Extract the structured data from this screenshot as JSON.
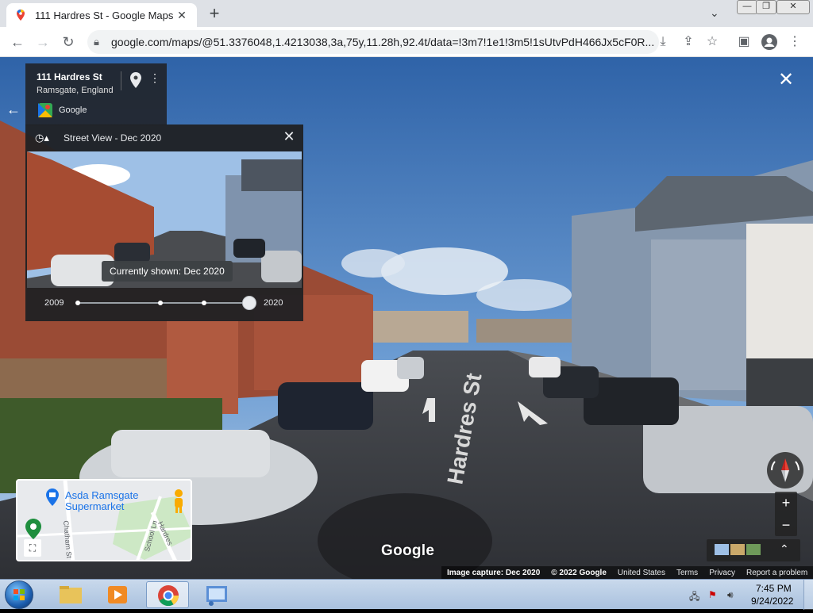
{
  "browser": {
    "tab_title": "111 Hardres St - Google Maps",
    "tab_close": "✕",
    "new_tab": "+",
    "tab_dropdown": "⌄",
    "url": "google.com/maps/@51.3376048,1.4213038,3a,75y,11.28h,92.4t/data=!3m7!1e1!3m5!1sUtvPdH466Jx5cF0R...",
    "window_controls": [
      "—",
      "❐",
      "✕"
    ]
  },
  "place": {
    "title": "111 Hardres St",
    "subtitle": "Ramsgate, England",
    "source": "Google"
  },
  "time_travel": {
    "header": "Street View - Dec 2020",
    "tooltip": "Currently shown: Dec 2020",
    "year_start": "2009",
    "year_end": "2020"
  },
  "minimap": {
    "poi_line1": "Asda Ramsgate",
    "poi_line2": "Supermarket",
    "streets": [
      "Chatham St",
      "School Ln",
      "Hardres"
    ]
  },
  "map": {
    "watermark": "Google",
    "road_text": "Hardres St"
  },
  "footer": {
    "capture": "Image capture: Dec 2020",
    "copyright": "© 2022 Google",
    "country": "United States",
    "terms": "Terms",
    "privacy": "Privacy",
    "report": "Report a problem"
  },
  "controls": {
    "zoom_in": "+",
    "zoom_out": "−",
    "close": "✕",
    "layers_expand": "⌃"
  },
  "taskbar": {
    "time": "7:45 PM",
    "date": "9/24/2022"
  },
  "colors": {
    "accent": "#1a73e8",
    "panel": "#202124",
    "taskbar": "#b9cde6"
  }
}
